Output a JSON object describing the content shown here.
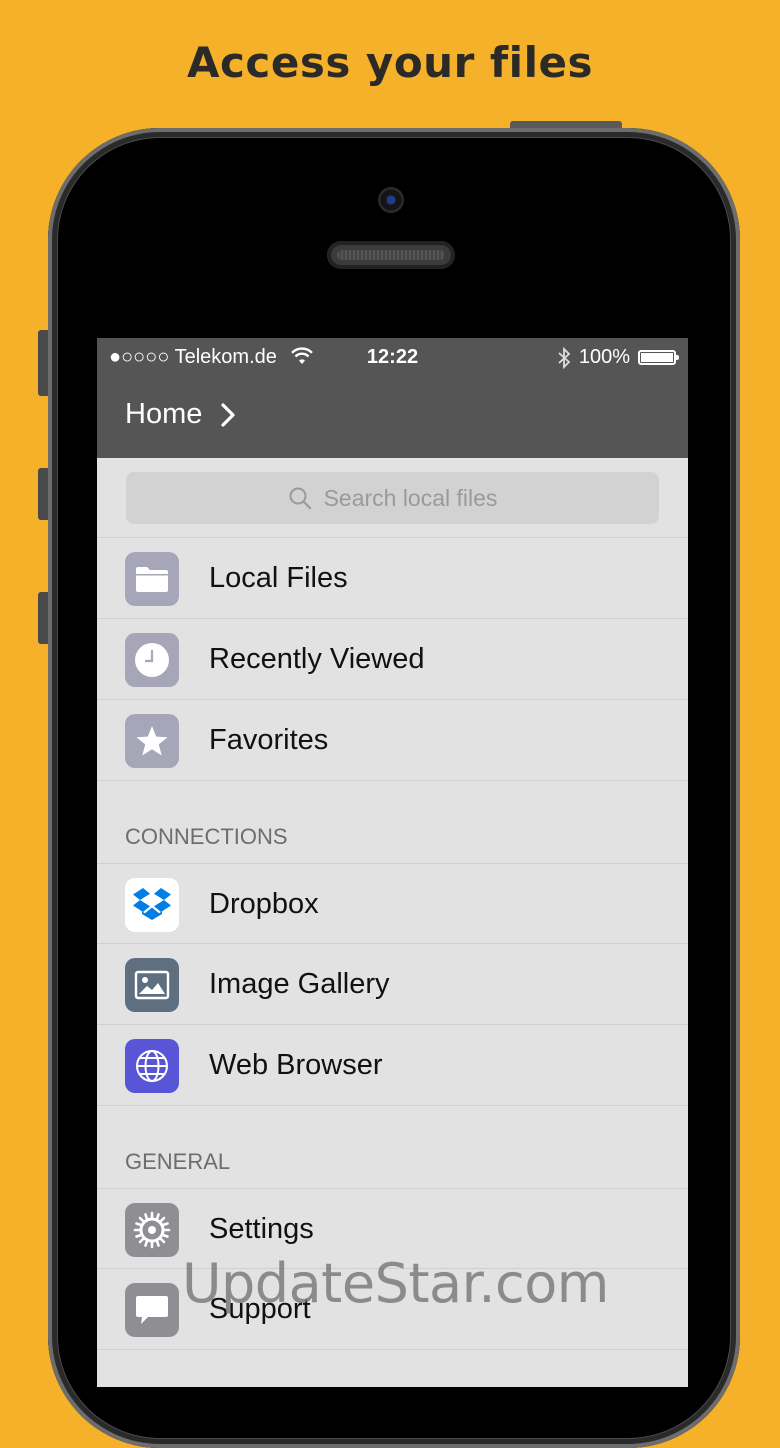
{
  "headline": "Access your files",
  "status_bar": {
    "carrier": "●○○○○ Telekom.de",
    "time": "12:22",
    "battery": "100%"
  },
  "nav": {
    "title": "Home"
  },
  "search": {
    "placeholder": "Search local files"
  },
  "main_items": [
    {
      "label": "Local Files",
      "icon": "folder-icon"
    },
    {
      "label": "Recently Viewed",
      "icon": "clock-icon"
    },
    {
      "label": "Favorites",
      "icon": "star-icon"
    }
  ],
  "connections": {
    "header": "CONNECTIONS",
    "items": [
      {
        "label": "Dropbox",
        "icon": "dropbox-icon"
      },
      {
        "label": "Image Gallery",
        "icon": "image-icon"
      },
      {
        "label": "Web Browser",
        "icon": "globe-icon"
      }
    ]
  },
  "general": {
    "header": "GENERAL",
    "items": [
      {
        "label": "Settings",
        "icon": "gear-icon"
      },
      {
        "label": "Support",
        "icon": "chat-bubble-icon"
      }
    ]
  },
  "watermark": "UpdateStar.com",
  "colors": {
    "background": "#F6B12A",
    "navbar": "#555555",
    "list_background": "#E2E2E2",
    "grey_icon": "#A6A6B8",
    "dropbox_blue": "#007EE5",
    "image_icon": "#5F6F80",
    "web_icon": "#5856D6"
  }
}
